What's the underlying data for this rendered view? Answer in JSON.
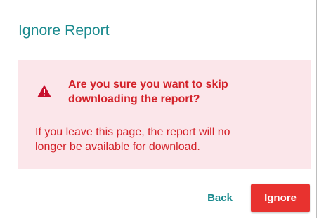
{
  "dialog": {
    "title": "Ignore Report"
  },
  "alert": {
    "icon": "warning-triangle-icon",
    "heading_line1": "Are you sure you want to skip",
    "heading_line2": "downloading the report?",
    "body_line1": "If you leave this page, the report will no",
    "body_line2": "longer be available for download."
  },
  "actions": {
    "back_label": "Back",
    "ignore_label": "Ignore"
  },
  "colors": {
    "title": "#1a8a8e",
    "alert_background": "#fbe6ea",
    "alert_text": "#d3222a",
    "primary_button": "#e8322f",
    "secondary_button_text": "#1a8a8e"
  }
}
